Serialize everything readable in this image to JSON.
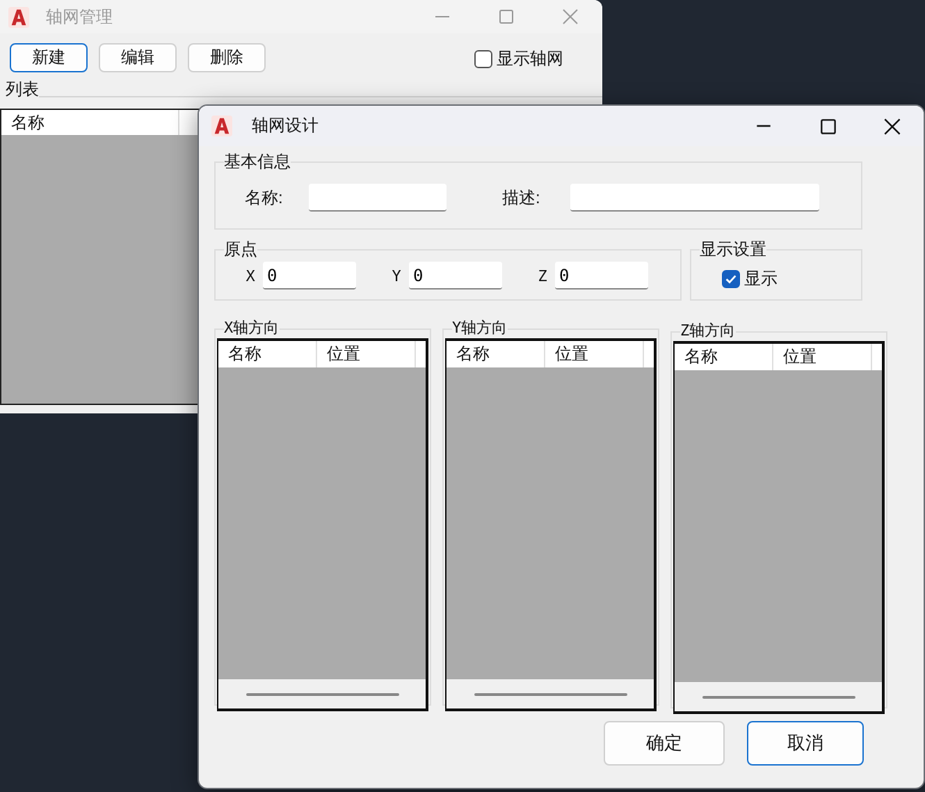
{
  "back_window": {
    "title": "轴网管理",
    "toolbar": [
      {
        "label": "新建",
        "focused": true
      },
      {
        "label": "编辑",
        "focused": false
      },
      {
        "label": "删除",
        "focused": false
      }
    ],
    "show_grid": {
      "label": "显示轴网",
      "checked": false
    },
    "list": {
      "title": "列表",
      "columns": [
        "名称"
      ]
    }
  },
  "front_window": {
    "title": "轴网设计",
    "basic_info": {
      "title": "基本信息",
      "fields": [
        {
          "label": "名称:"
        },
        {
          "label": "描述:"
        }
      ]
    },
    "origin": {
      "title": "原点",
      "fields": [
        {
          "label": "X",
          "value": "0"
        },
        {
          "label": "Y",
          "value": "0"
        },
        {
          "label": "Z",
          "value": "0"
        }
      ]
    },
    "display": {
      "title": "显示设置",
      "checkbox": {
        "label": "显示",
        "checked": true
      }
    },
    "axes": [
      {
        "title": "X轴方向",
        "columns": [
          "名称",
          "位置"
        ]
      },
      {
        "title": "Y轴方向",
        "columns": [
          "名称",
          "位置"
        ]
      },
      {
        "title": "Z轴方向",
        "columns": [
          "名称",
          "位置"
        ]
      }
    ],
    "buttons": [
      {
        "label": "确定",
        "focused": false
      },
      {
        "label": "取消",
        "focused": true
      }
    ]
  }
}
